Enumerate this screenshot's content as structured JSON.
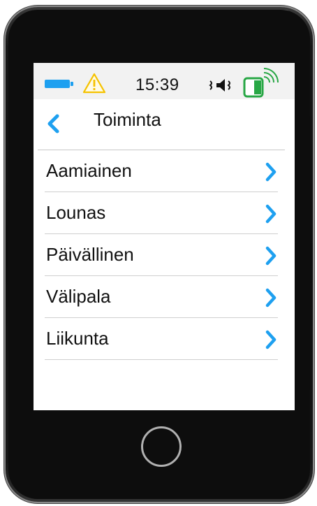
{
  "status_bar": {
    "time": "15:39",
    "battery_icon": "battery-icon",
    "warning_icon": "warning-icon",
    "vibrate_icon": "vibrate-icon",
    "signal_icon": "wireless-signal-icon",
    "battery_color": "#1ea0f0",
    "warning_color": "#f5c200",
    "signal_color": "#28a745"
  },
  "header": {
    "title": "Toiminta",
    "back_icon": "chevron-left-icon"
  },
  "menu": {
    "items": [
      {
        "label": "Aamiainen"
      },
      {
        "label": "Lounas"
      },
      {
        "label": "Päivällinen"
      },
      {
        "label": "Välipala"
      },
      {
        "label": "Liikunta"
      }
    ],
    "chevron_icon": "chevron-right-icon",
    "accent_color": "#1ea0f0"
  },
  "device": {
    "home_button_icon": "home-button-ring"
  }
}
